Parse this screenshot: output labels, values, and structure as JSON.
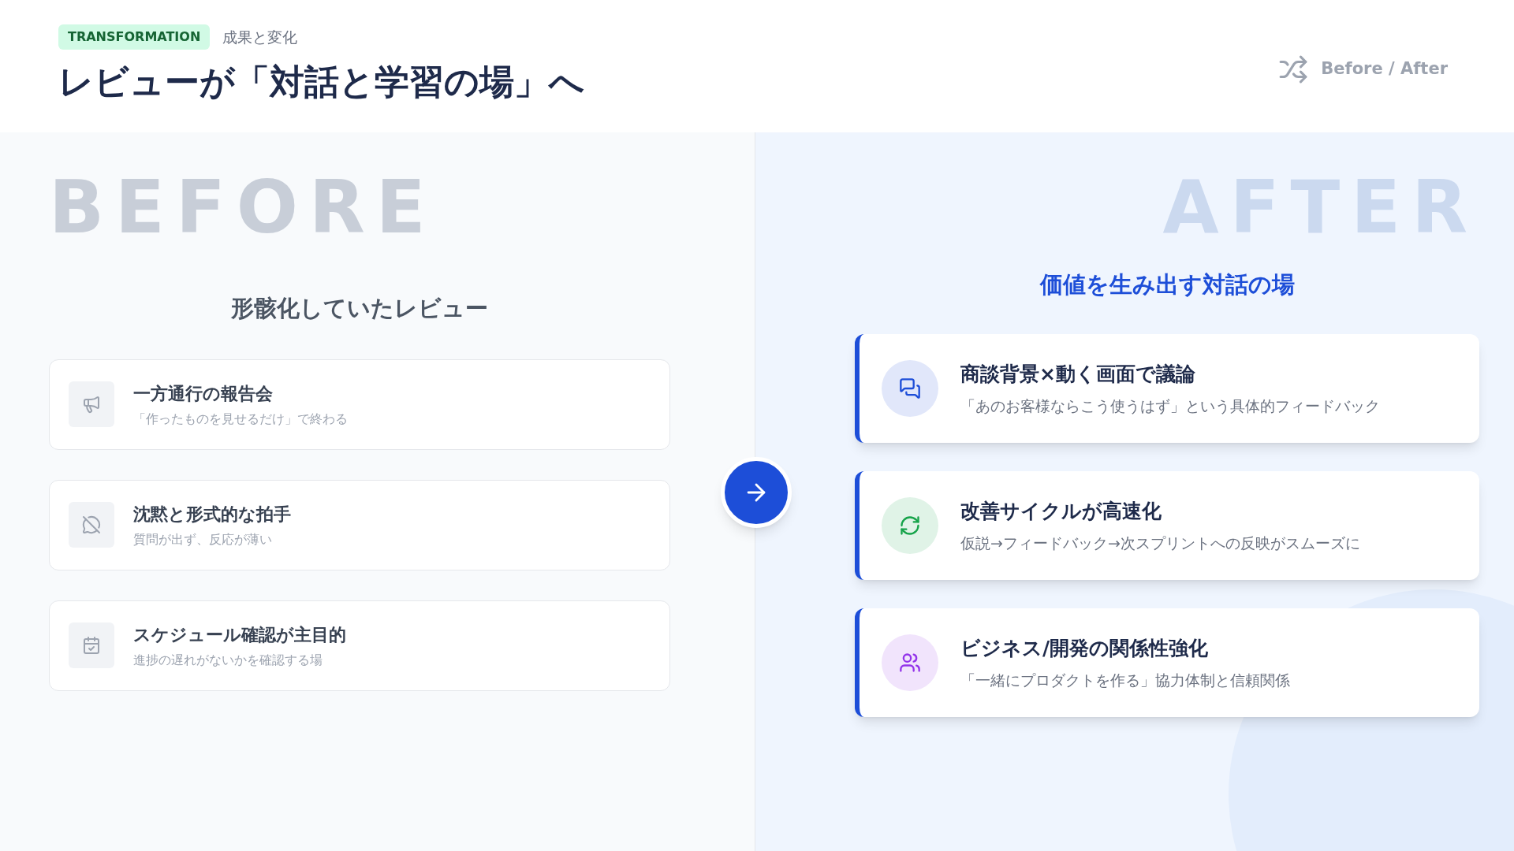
{
  "header": {
    "badge": "TRANSFORMATION",
    "subtitle": "成果と変化",
    "title": "レビューが「対話と学習の場」へ",
    "switch_label": "Before / After"
  },
  "before": {
    "watermark": "BEFORE",
    "heading": "形骸化していたレビュー",
    "items": [
      {
        "kind": "megaphone",
        "title": "一方通行の報告会",
        "description": "「作ったものを見せるだけ」で終わる"
      },
      {
        "kind": "comment-off",
        "title": "沈黙と形式的な拍手",
        "description": "質問が出ず、反応が薄い"
      },
      {
        "kind": "calendar-check",
        "title": "スケジュール確認が主目的",
        "description": "進捗の遅れがないかを確認する場"
      }
    ]
  },
  "after": {
    "watermark": "AFTER",
    "heading": "価値を生み出す対話の場",
    "items": [
      {
        "kind": "comments",
        "color": "#1d4ed8",
        "title": "商談背景×動く画面で議論",
        "description": "「あのお客様ならこう使うはず」という具体的フィードバック"
      },
      {
        "kind": "refresh",
        "color": "#16a34a",
        "title": "改善サイクルが高速化",
        "description": "仮説→フィードバック→次スプリントへの反映がスムーズに"
      },
      {
        "kind": "users",
        "color": "#9333ea",
        "title": "ビジネス/開発の関係性強化",
        "description": "「一緒にプロダクトを作る」協力体制と信頼関係"
      }
    ]
  }
}
